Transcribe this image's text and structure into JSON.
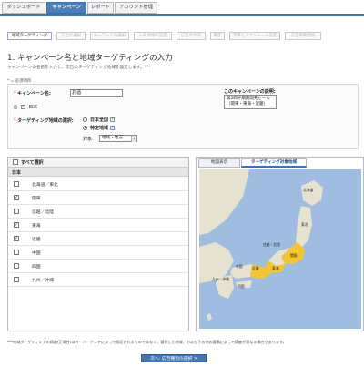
{
  "tabs": [
    "ダッシュボード",
    "キャンペーン",
    "レポート",
    "アカウント管理"
  ],
  "steps": [
    {
      "label": "地域ターゲティング",
      "active": true
    },
    {
      "label": "広告の選択",
      "active": false
    },
    {
      "label": "キーワードの選択",
      "active": false
    },
    {
      "label": "入札価格の設定",
      "active": false
    },
    {
      "label": "広告の作成",
      "active": false
    },
    {
      "label": "確認",
      "active": false
    },
    {
      "label": "予算とスケジュール設定",
      "active": false
    },
    {
      "label": "広告掲載開始",
      "active": false
    }
  ],
  "page": {
    "title": "1. キャンペーン名と地域ターゲティングの入力",
    "description": "キャンペーンの名前を入力し、広告のターゲティング地域を設定します。***",
    "required_note": "= 必須項目",
    "required_mark": "*"
  },
  "form": {
    "campaign_name_label": "キャンペーン名:",
    "campaign_name_required": "*",
    "campaign_name_value": "お酒",
    "flag_marker": "日",
    "country_value": "日本",
    "targeting_label": "ターゲティング地域の選択:",
    "targeting_required": "*",
    "radio_all": "日本全国",
    "radio_specific": "特定地域",
    "target_label": "対象:",
    "target_select": "地域・地方",
    "description_label": "このキャンペーンの説明:",
    "description_value": "第2四半期期間先セール（関東・東海・近畿）",
    "help_icon": "?"
  },
  "region_list": {
    "select_all": "すべて選択",
    "group": "日本",
    "rows": [
      {
        "label": "北海道／東北",
        "checked": false
      },
      {
        "label": "関東",
        "checked": true
      },
      {
        "label": "信越／北陸",
        "checked": false
      },
      {
        "label": "東海",
        "checked": true
      },
      {
        "label": "近畿",
        "checked": true
      },
      {
        "label": "中国",
        "checked": false
      },
      {
        "label": "四国",
        "checked": false
      },
      {
        "label": "九州／沖縄",
        "checked": false
      }
    ]
  },
  "map": {
    "tab_map": "地図表示",
    "tab_targeted": "ターゲティング対象地域",
    "labels": [
      "北海道",
      "東北",
      "信越・北陸",
      "関東",
      "近畿",
      "東海",
      "中国",
      "四国",
      "九州・沖縄"
    ]
  },
  "footer": {
    "note": "***地域ターゲティングの精度(正確性)はオーバーチュアによって保証されるものではなく、選択した地域、およびその他の要素によって精度が異なる場合があります。",
    "next_button": "次へ: 広告種別の選択 >"
  },
  "colors": {
    "accent": "#3b73b1",
    "highlight_region": "#f4c531",
    "required": "#cc0000"
  }
}
